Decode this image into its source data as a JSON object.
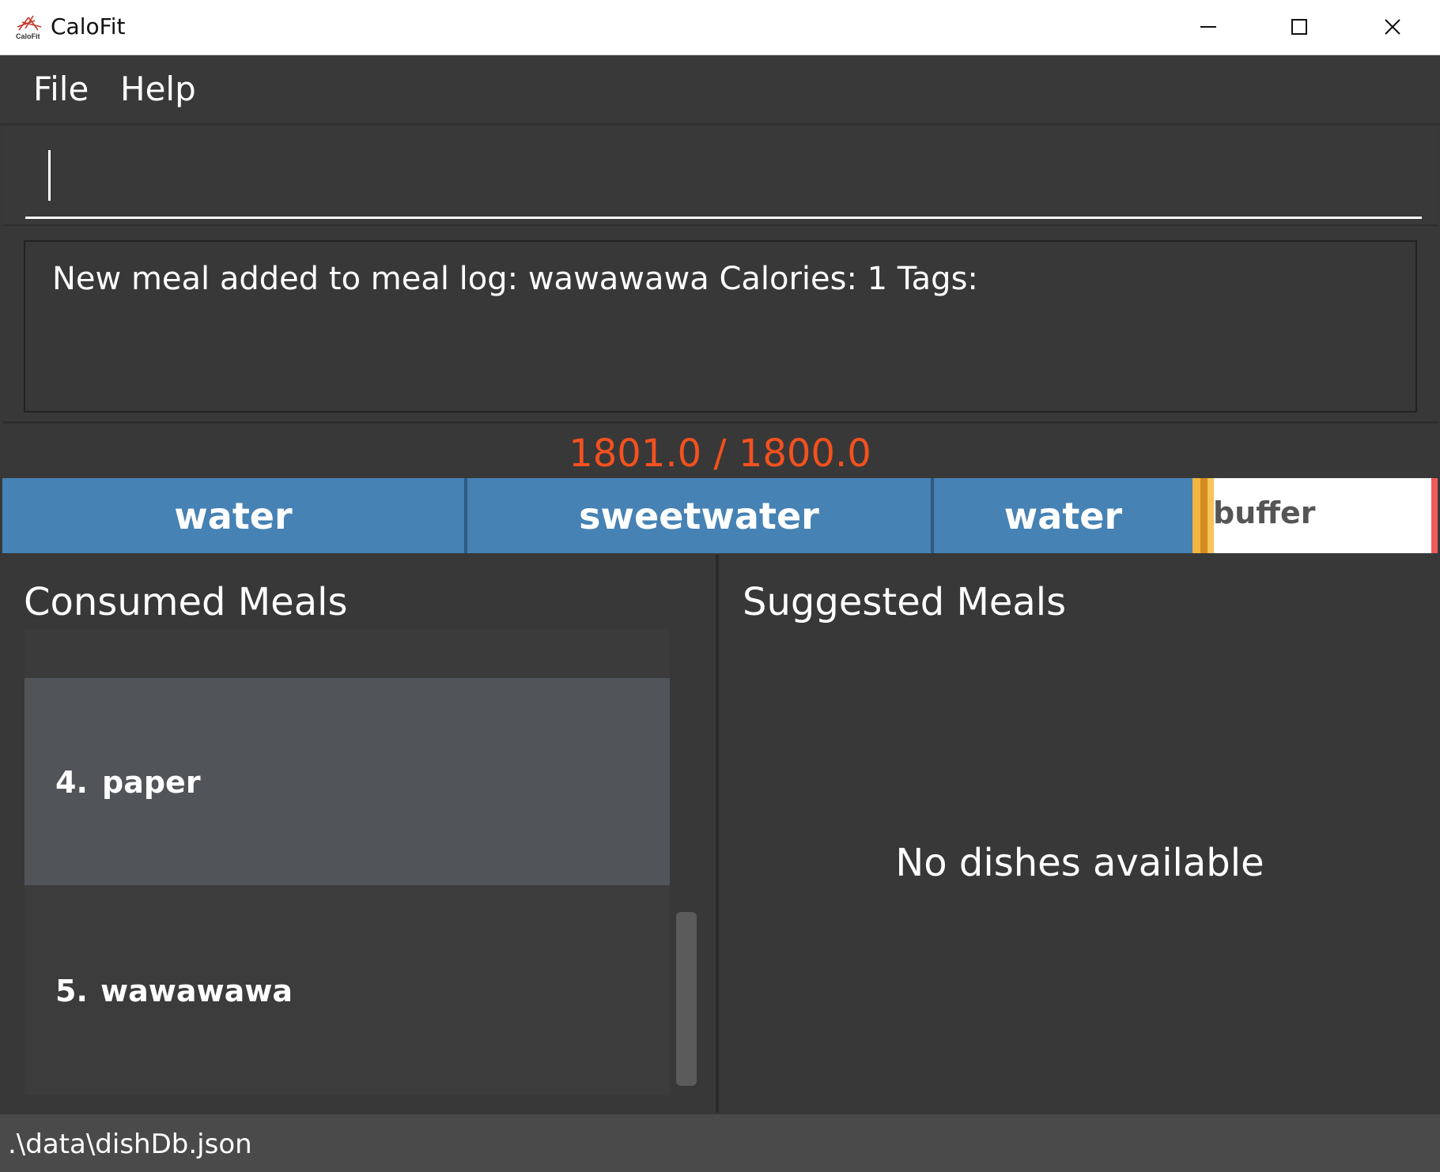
{
  "window": {
    "title": "CaloFit",
    "icon": "calofit-logo-icon",
    "icon_label": "CaloFit"
  },
  "menu": {
    "items": [
      "File",
      "Help"
    ]
  },
  "command": {
    "value": ""
  },
  "result": {
    "message": "New meal added to meal log: wawawawa Calories: 1 Tags:"
  },
  "calories": {
    "text": "1801.0 / 1800.0",
    "color": "#f4511e"
  },
  "progress": {
    "segments": [
      "water",
      "sweetwater",
      "water"
    ],
    "buffer_label": "buffer",
    "segment_color": "#4682b4"
  },
  "consumed": {
    "title": "Consumed Meals",
    "items": [
      {
        "index": "4.",
        "name": "paper",
        "selected": true
      },
      {
        "index": "5.",
        "name": "wawawawa",
        "selected": false
      }
    ]
  },
  "suggested": {
    "title": "Suggested Meals",
    "empty_text": "No dishes available"
  },
  "status": {
    "path": ".\\data\\dishDb.json"
  }
}
